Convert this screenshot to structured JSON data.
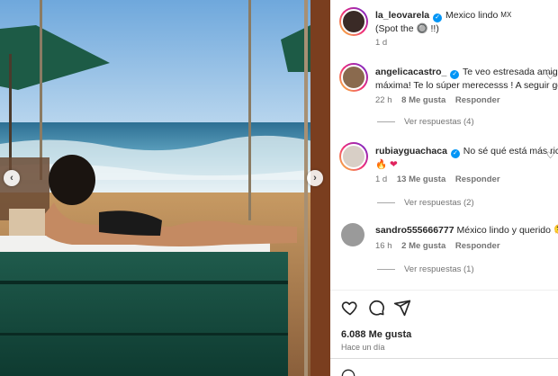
{
  "post": {
    "author": "la_leovarela",
    "caption_line1": "Mexico lindo",
    "caption_flag": "MX",
    "caption_line2": "(Spot the 🔘 !!)",
    "caption_time": "1 d"
  },
  "comments": [
    {
      "user": "angelicacastro_",
      "verified": true,
      "text_line1": "Te veo estresada amiga!!!",
      "text_line2": "máxima! Te lo súper merecesss ! A seguir go",
      "time": "22 h",
      "likes": "8 Me gusta",
      "reply": "Responder",
      "view_replies": "Ver respuestas (4)"
    },
    {
      "user": "rubiayguachaca",
      "verified": true,
      "text_line1": "No sé qué está más rico",
      "text_line2": "🔥 ❤",
      "time": "1 d",
      "likes": "13 Me gusta",
      "reply": "Responder",
      "view_replies": "Ver respuestas (2)"
    },
    {
      "user": "sandro555666777",
      "verified": false,
      "text_line1": "México lindo y querido 🫠",
      "time": "16 h",
      "likes": "2 Me gusta",
      "reply": "Responder",
      "view_replies": "Ver respuestas (1)"
    }
  ],
  "footer": {
    "likes": "6.088 Me gusta",
    "date": "Hace un día"
  },
  "icons": {
    "like": "heart-icon",
    "comment": "comment-icon",
    "share": "share-icon",
    "emoji": "emoji-icon",
    "prev": "chevron-left-icon",
    "next": "chevron-right-icon"
  },
  "nav": {
    "prev_glyph": "‹",
    "next_glyph": "›"
  }
}
